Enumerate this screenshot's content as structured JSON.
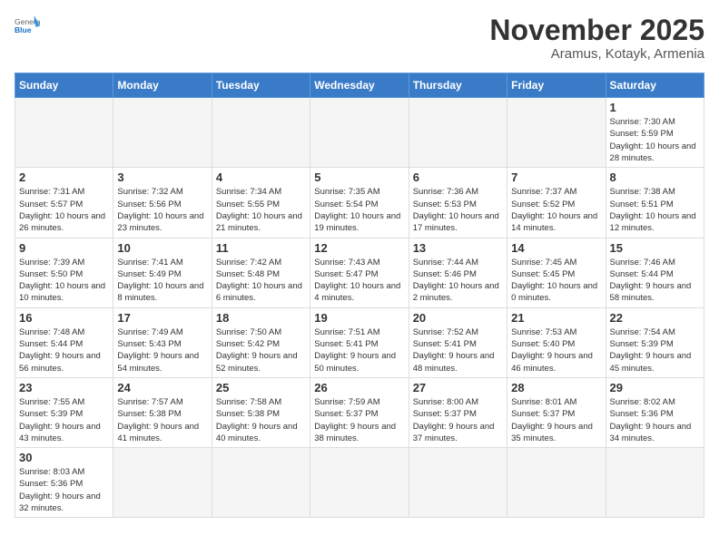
{
  "logo": {
    "general": "General",
    "blue": "Blue"
  },
  "title": "November 2025",
  "location": "Aramus, Kotayk, Armenia",
  "weekdays": [
    "Sunday",
    "Monday",
    "Tuesday",
    "Wednesday",
    "Thursday",
    "Friday",
    "Saturday"
  ],
  "days": [
    {
      "date": "",
      "info": ""
    },
    {
      "date": "",
      "info": ""
    },
    {
      "date": "",
      "info": ""
    },
    {
      "date": "",
      "info": ""
    },
    {
      "date": "",
      "info": ""
    },
    {
      "date": "",
      "info": ""
    },
    {
      "date": "1",
      "info": "Sunrise: 7:30 AM\nSunset: 5:59 PM\nDaylight: 10 hours and 28 minutes."
    },
    {
      "date": "2",
      "info": "Sunrise: 7:31 AM\nSunset: 5:57 PM\nDaylight: 10 hours and 26 minutes."
    },
    {
      "date": "3",
      "info": "Sunrise: 7:32 AM\nSunset: 5:56 PM\nDaylight: 10 hours and 23 minutes."
    },
    {
      "date": "4",
      "info": "Sunrise: 7:34 AM\nSunset: 5:55 PM\nDaylight: 10 hours and 21 minutes."
    },
    {
      "date": "5",
      "info": "Sunrise: 7:35 AM\nSunset: 5:54 PM\nDaylight: 10 hours and 19 minutes."
    },
    {
      "date": "6",
      "info": "Sunrise: 7:36 AM\nSunset: 5:53 PM\nDaylight: 10 hours and 17 minutes."
    },
    {
      "date": "7",
      "info": "Sunrise: 7:37 AM\nSunset: 5:52 PM\nDaylight: 10 hours and 14 minutes."
    },
    {
      "date": "8",
      "info": "Sunrise: 7:38 AM\nSunset: 5:51 PM\nDaylight: 10 hours and 12 minutes."
    },
    {
      "date": "9",
      "info": "Sunrise: 7:39 AM\nSunset: 5:50 PM\nDaylight: 10 hours and 10 minutes."
    },
    {
      "date": "10",
      "info": "Sunrise: 7:41 AM\nSunset: 5:49 PM\nDaylight: 10 hours and 8 minutes."
    },
    {
      "date": "11",
      "info": "Sunrise: 7:42 AM\nSunset: 5:48 PM\nDaylight: 10 hours and 6 minutes."
    },
    {
      "date": "12",
      "info": "Sunrise: 7:43 AM\nSunset: 5:47 PM\nDaylight: 10 hours and 4 minutes."
    },
    {
      "date": "13",
      "info": "Sunrise: 7:44 AM\nSunset: 5:46 PM\nDaylight: 10 hours and 2 minutes."
    },
    {
      "date": "14",
      "info": "Sunrise: 7:45 AM\nSunset: 5:45 PM\nDaylight: 10 hours and 0 minutes."
    },
    {
      "date": "15",
      "info": "Sunrise: 7:46 AM\nSunset: 5:44 PM\nDaylight: 9 hours and 58 minutes."
    },
    {
      "date": "16",
      "info": "Sunrise: 7:48 AM\nSunset: 5:44 PM\nDaylight: 9 hours and 56 minutes."
    },
    {
      "date": "17",
      "info": "Sunrise: 7:49 AM\nSunset: 5:43 PM\nDaylight: 9 hours and 54 minutes."
    },
    {
      "date": "18",
      "info": "Sunrise: 7:50 AM\nSunset: 5:42 PM\nDaylight: 9 hours and 52 minutes."
    },
    {
      "date": "19",
      "info": "Sunrise: 7:51 AM\nSunset: 5:41 PM\nDaylight: 9 hours and 50 minutes."
    },
    {
      "date": "20",
      "info": "Sunrise: 7:52 AM\nSunset: 5:41 PM\nDaylight: 9 hours and 48 minutes."
    },
    {
      "date": "21",
      "info": "Sunrise: 7:53 AM\nSunset: 5:40 PM\nDaylight: 9 hours and 46 minutes."
    },
    {
      "date": "22",
      "info": "Sunrise: 7:54 AM\nSunset: 5:39 PM\nDaylight: 9 hours and 45 minutes."
    },
    {
      "date": "23",
      "info": "Sunrise: 7:55 AM\nSunset: 5:39 PM\nDaylight: 9 hours and 43 minutes."
    },
    {
      "date": "24",
      "info": "Sunrise: 7:57 AM\nSunset: 5:38 PM\nDaylight: 9 hours and 41 minutes."
    },
    {
      "date": "25",
      "info": "Sunrise: 7:58 AM\nSunset: 5:38 PM\nDaylight: 9 hours and 40 minutes."
    },
    {
      "date": "26",
      "info": "Sunrise: 7:59 AM\nSunset: 5:37 PM\nDaylight: 9 hours and 38 minutes."
    },
    {
      "date": "27",
      "info": "Sunrise: 8:00 AM\nSunset: 5:37 PM\nDaylight: 9 hours and 37 minutes."
    },
    {
      "date": "28",
      "info": "Sunrise: 8:01 AM\nSunset: 5:37 PM\nDaylight: 9 hours and 35 minutes."
    },
    {
      "date": "29",
      "info": "Sunrise: 8:02 AM\nSunset: 5:36 PM\nDaylight: 9 hours and 34 minutes."
    },
    {
      "date": "30",
      "info": "Sunrise: 8:03 AM\nSunset: 5:36 PM\nDaylight: 9 hours and 32 minutes."
    }
  ]
}
